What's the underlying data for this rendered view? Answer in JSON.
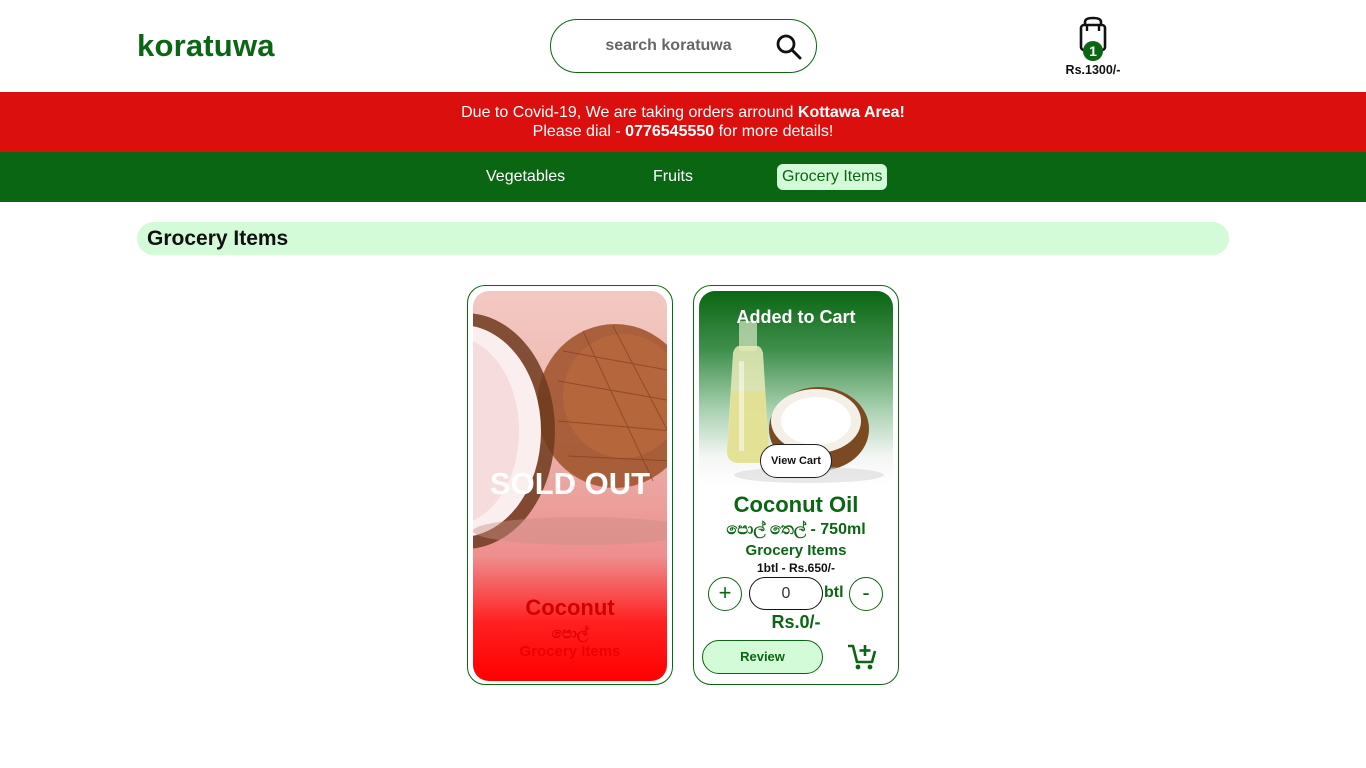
{
  "header": {
    "logo": "koratuwa",
    "search_placeholder": "search koratuwa",
    "cart_count": "1",
    "cart_total": "Rs.1300/-"
  },
  "notice": {
    "line1_prefix": "Due to Covid-19, We are taking orders arround ",
    "line1_bold": "Kottawa Area!",
    "line2_prefix": "Please dial - ",
    "line2_bold": "0776545550",
    "line2_suffix": " for more details!",
    "background": "#dc0f0f"
  },
  "nav": {
    "items": [
      {
        "label": "Vegetables",
        "active": false
      },
      {
        "label": "Fruits",
        "active": false
      },
      {
        "label": "Grocery Items",
        "active": true
      }
    ]
  },
  "section": {
    "title": "Grocery Items"
  },
  "products": [
    {
      "status": "SOLD OUT",
      "name": "Coconut",
      "name_sinhala": "පොල්",
      "category": "Grocery Items"
    },
    {
      "status": "Added to Cart",
      "view_cart_label": "View Cart",
      "name": "Coconut Oil",
      "name_sinhala": "පොල් තෙල් - 750ml",
      "category": "Grocery Items",
      "unit_price": "1btl - Rs.650/-",
      "plus_label": "+",
      "minus_label": "-",
      "quantity": "0",
      "unit": "btl",
      "total": "Rs.0/-",
      "review_label": "Review"
    }
  ],
  "colors": {
    "brand_green": "#0b6613",
    "light_green": "#d4fbd7",
    "alert_red": "#dc0f0f"
  }
}
